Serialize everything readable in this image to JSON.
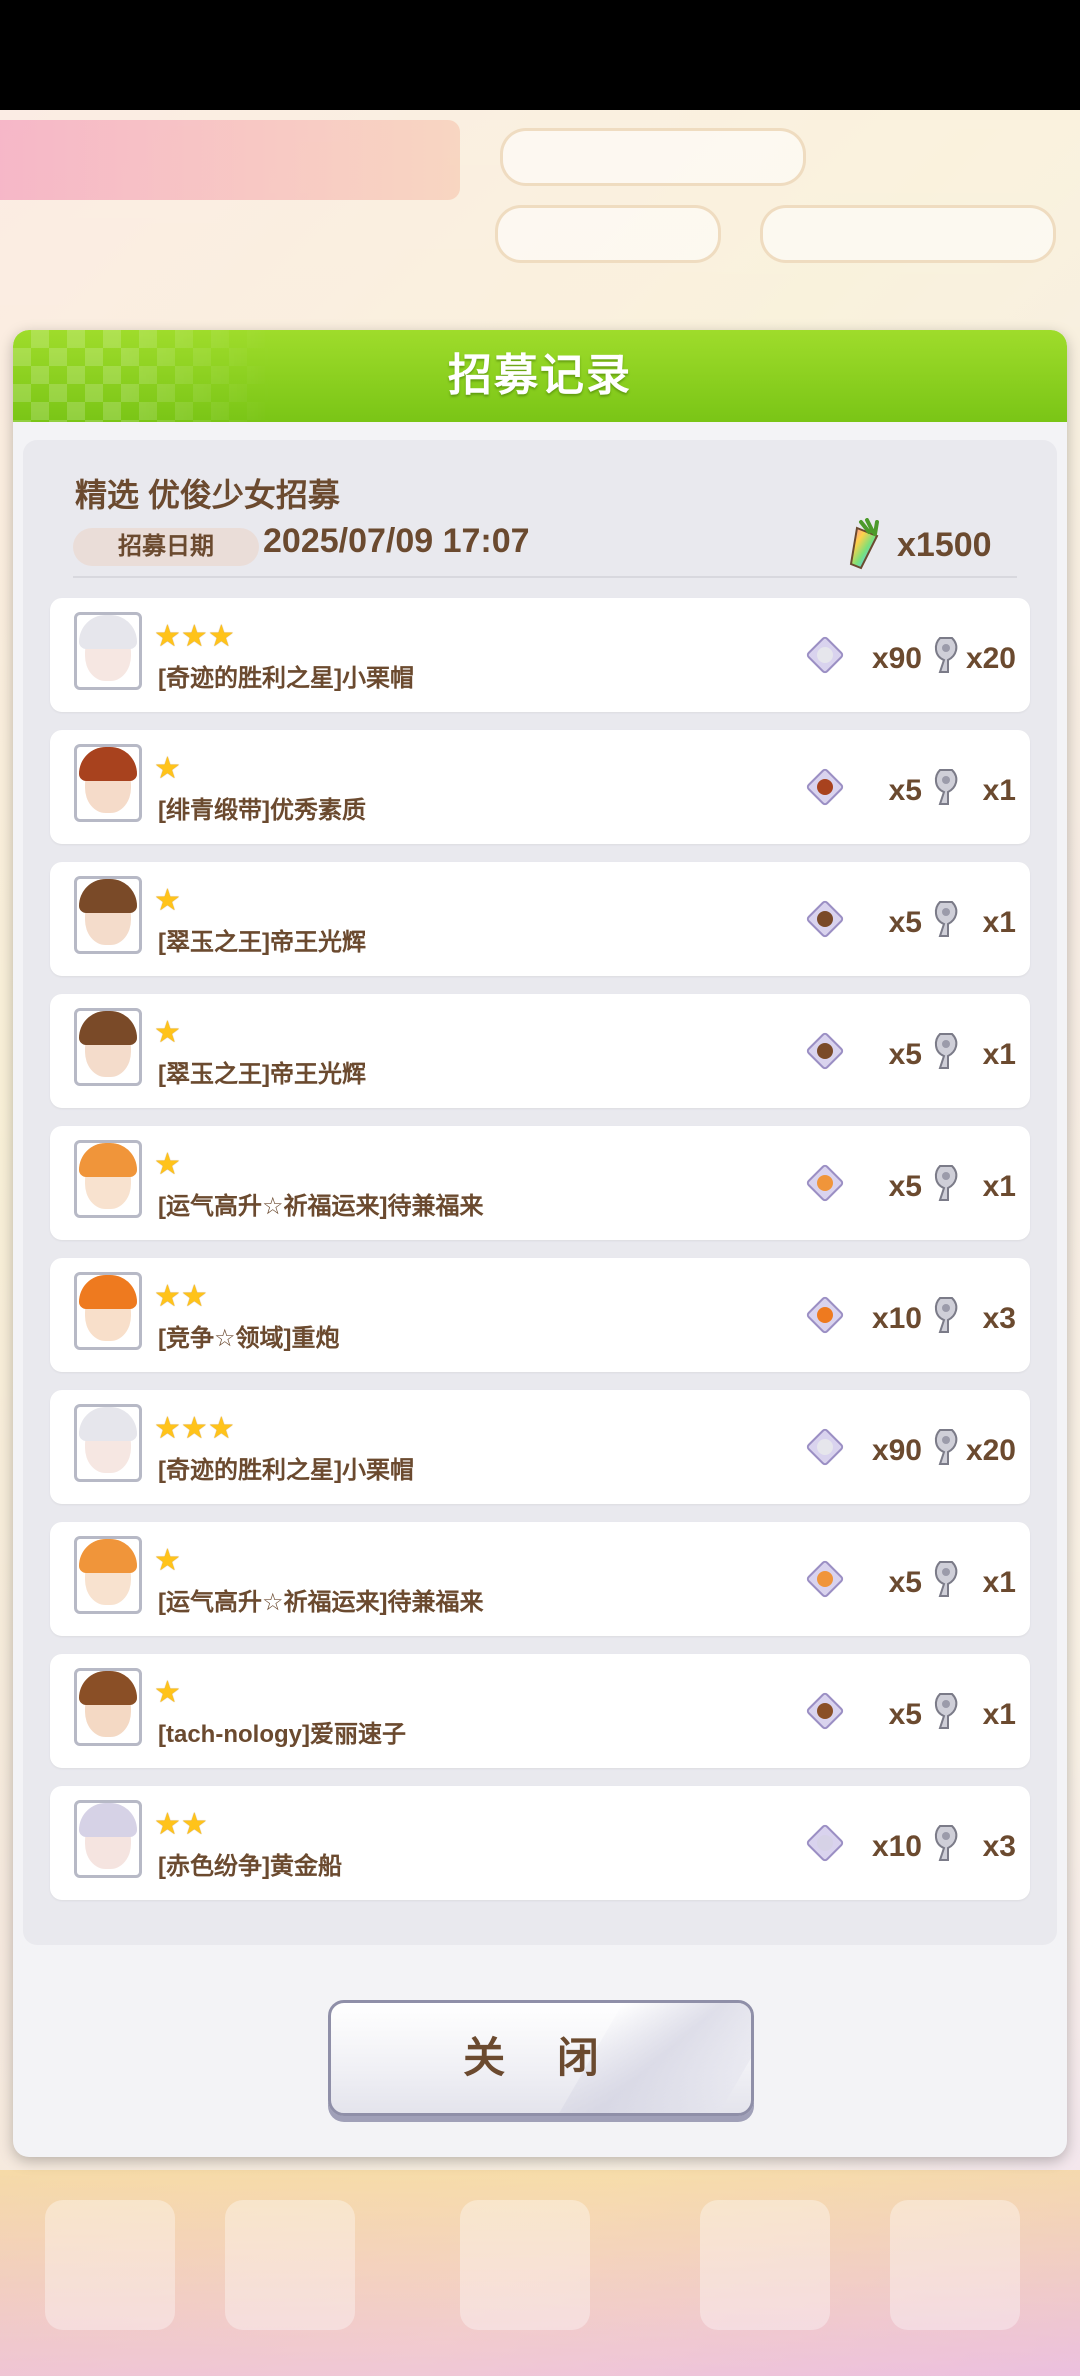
{
  "dialog": {
    "title": "招募记录",
    "banner_name": "精选 优俊少女招募",
    "date_label": "招募日期",
    "date_value": "2025/07/09 17:07",
    "cost": "x1500",
    "close_label": "关 闭"
  },
  "records": [
    {
      "stars": 3,
      "name": "[奇迹的胜利之星]小栗帽",
      "pieces": "x90",
      "trophies": "x20",
      "hair": "#e6e6ec",
      "face": "#f6e7e2"
    },
    {
      "stars": 1,
      "name": "[绯青缎带]优秀素质",
      "pieces": "x5",
      "trophies": "x1",
      "hair": "#a8421e",
      "face": "#f5dbc9"
    },
    {
      "stars": 1,
      "name": "[翠玉之王]帝王光辉",
      "pieces": "x5",
      "trophies": "x1",
      "hair": "#7a4a28",
      "face": "#f4dccb"
    },
    {
      "stars": 1,
      "name": "[翠玉之王]帝王光辉",
      "pieces": "x5",
      "trophies": "x1",
      "hair": "#7a4a28",
      "face": "#f4dccb"
    },
    {
      "stars": 1,
      "name": "[运气高升☆祈福运来]待兼福来",
      "pieces": "x5",
      "trophies": "x1",
      "hair": "#f0953a",
      "face": "#f8e2cf"
    },
    {
      "stars": 2,
      "name": "[竞争☆领域]重炮",
      "pieces": "x10",
      "trophies": "x3",
      "hair": "#ee7a1f",
      "face": "#f8dfca"
    },
    {
      "stars": 3,
      "name": "[奇迹的胜利之星]小栗帽",
      "pieces": "x90",
      "trophies": "x20",
      "hair": "#e6e6ec",
      "face": "#f6e7e2"
    },
    {
      "stars": 1,
      "name": "[运气高升☆祈福运来]待兼福来",
      "pieces": "x5",
      "trophies": "x1",
      "hair": "#f0953a",
      "face": "#f8e2cf"
    },
    {
      "stars": 1,
      "name": "[tach-nology]爱丽速子",
      "pieces": "x5",
      "trophies": "x1",
      "hair": "#8a4f26",
      "face": "#f4d9c4"
    },
    {
      "stars": 2,
      "name": "[赤色纷争]黄金船",
      "pieces": "x10",
      "trophies": "x3",
      "hair": "#d6d2e6",
      "face": "#f5e4e0"
    }
  ],
  "colors": {
    "header_green": "#7ac516",
    "text_brown": "#6b4a2f",
    "star_gold": "#ffc31a"
  }
}
